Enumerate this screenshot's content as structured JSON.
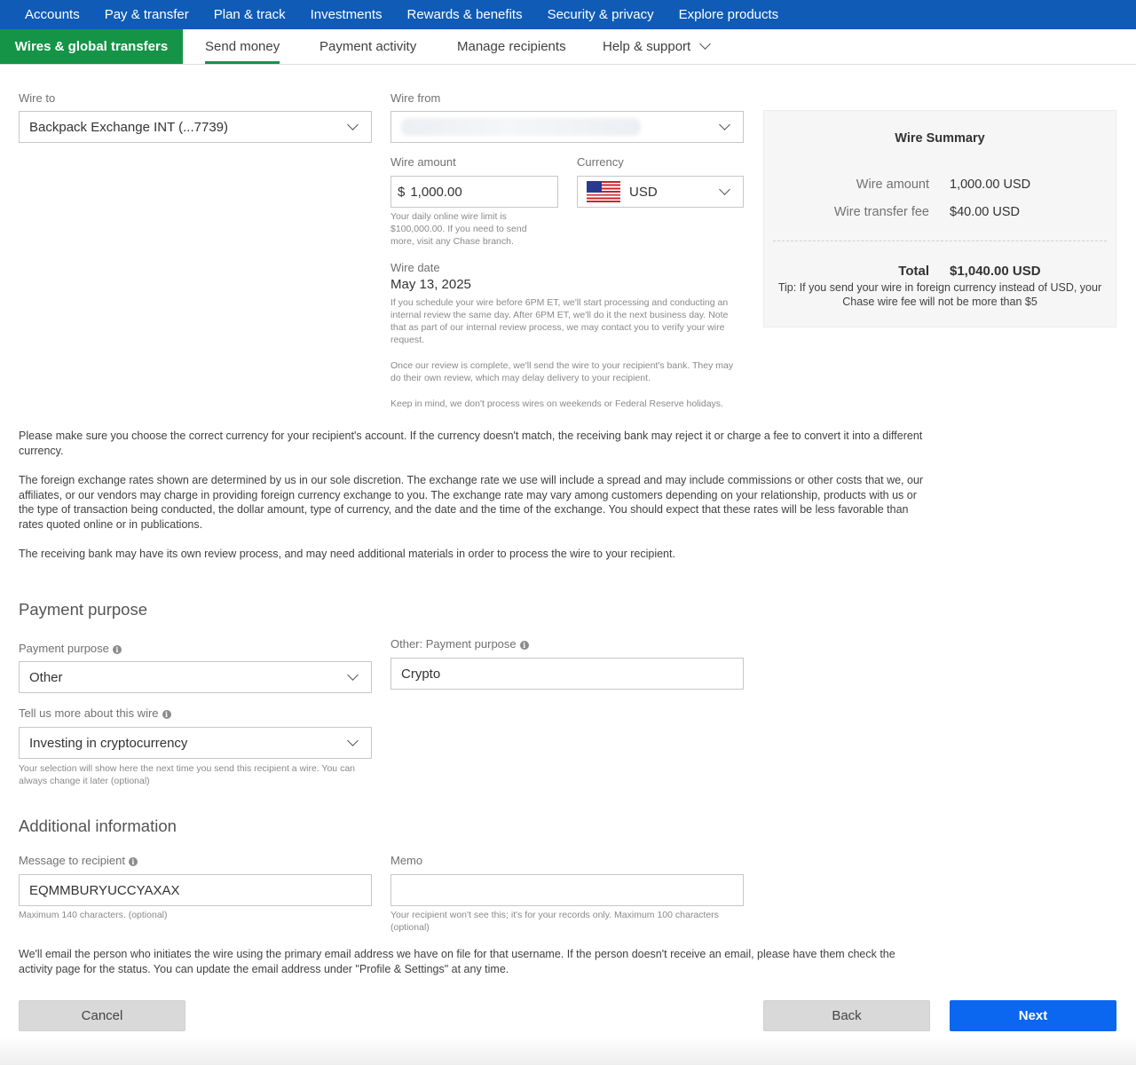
{
  "topnav": {
    "items": [
      "Accounts",
      "Pay & transfer",
      "Plan & track",
      "Investments",
      "Rewards & benefits",
      "Security & privacy",
      "Explore products"
    ]
  },
  "subnav": {
    "active": "Wires & global transfers",
    "tabs": [
      "Send money",
      "Payment activity",
      "Manage recipients",
      "Help & support"
    ]
  },
  "wire_to": {
    "label": "Wire to",
    "value": "Backpack Exchange INT (...7739)"
  },
  "wire_from": {
    "label": "Wire from",
    "value": ""
  },
  "wire_amount": {
    "label": "Wire amount",
    "symbol": "$",
    "value": "1,000.00",
    "hint": "Your daily online wire limit is $100,000.00. If you need to send more, visit any Chase branch."
  },
  "currency": {
    "label": "Currency",
    "value": "USD",
    "flag_icon": "us-flag-icon"
  },
  "wire_date": {
    "label": "Wire date",
    "value": "May 13, 2025",
    "note1": "If you schedule your wire before 6PM ET, we'll start processing and conducting an internal review the same day. After 6PM ET, we'll do it the next business day. Note that as part of our internal review process, we may contact you to verify your wire request.",
    "note2": "Once our review is complete, we'll send the wire to your recipient's bank. They may do their own review, which may delay delivery to your recipient.",
    "note3": "Keep in mind, we don't process wires on weekends or Federal Reserve holidays."
  },
  "summary": {
    "title": "Wire Summary",
    "amount_label": "Wire amount",
    "amount_value": "1,000.00 USD",
    "fee_label": "Wire transfer fee",
    "fee_value": "$40.00 USD",
    "total_label": "Total",
    "total_value": "$1,040.00 USD",
    "tip": "Tip: If you send your wire in foreign currency instead of USD, your Chase wire fee will not be more than $5"
  },
  "disclaimers": {
    "p1": "Please make sure you choose the correct currency for your recipient's account. If the currency doesn't match, the receiving bank may reject it or charge a fee to convert it into a different currency.",
    "p2": "The foreign exchange rates shown are determined by us in our sole discretion. The exchange rate we use will include a spread and may include commissions or other costs that we, our affiliates, or our vendors may charge in providing foreign currency exchange to you. The exchange rate may vary among customers depending on your relationship, products with us or the type of transaction being conducted, the dollar amount, type of currency, and the date and the time of the exchange. You should expect that these rates will be less favorable than rates quoted online or in publications.",
    "p3": "The receiving bank may have its own review process, and may need additional materials in order to process the wire to your recipient."
  },
  "payment_purpose": {
    "section_title": "Payment purpose",
    "purpose_label": "Payment purpose",
    "purpose_value": "Other",
    "other_label": "Other: Payment purpose",
    "other_value": "Crypto",
    "more_label": "Tell us more about this wire",
    "more_value": "Investing in cryptocurrency",
    "more_hint": "Your selection will show here the next time you send this recipient a wire. You can always change it later (optional)"
  },
  "additional": {
    "section_title": "Additional information",
    "message_label": "Message to recipient",
    "message_value": "EQMMBURYUCCYAXAX",
    "message_hint": "Maximum 140 characters. (optional)",
    "memo_label": "Memo",
    "memo_value": "",
    "memo_hint": "Your recipient won't see this; it's for your records only. Maximum 100 characters (optional)"
  },
  "email_note": "We'll email the person who initiates the wire using the primary email address we have on file for that username. If the person doesn't receive an email, please have them check the activity page for the status. You can update the email address under \"Profile & Settings\" at any time.",
  "buttons": {
    "cancel": "Cancel",
    "back": "Back",
    "next": "Next"
  },
  "info_icon_glyph": "i",
  "colors": {
    "nav_blue": "#0f5bb5",
    "active_green": "#159447",
    "primary_button": "#0b66f0"
  }
}
